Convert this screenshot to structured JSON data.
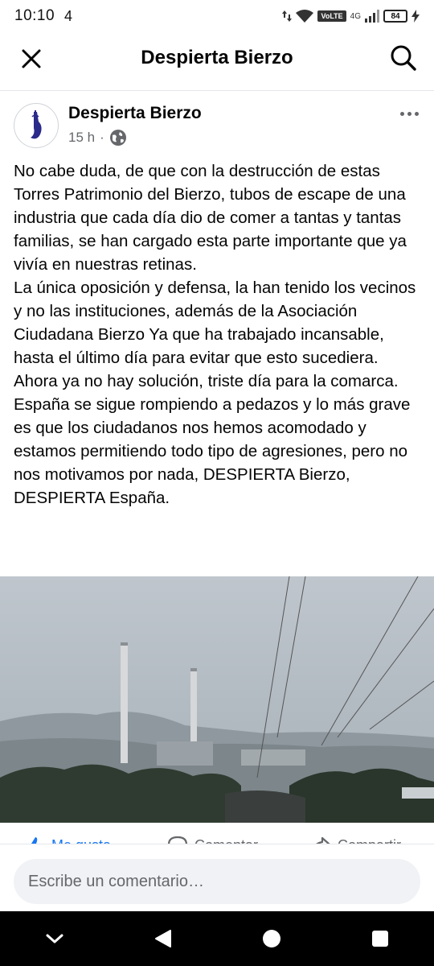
{
  "status_bar": {
    "time": "10:10",
    "extra": "4",
    "volte": "VoLTE",
    "network": "4G",
    "battery": "84"
  },
  "header": {
    "title": "Despierta Bierzo",
    "icons": [
      "close-icon",
      "search-icon"
    ]
  },
  "post": {
    "author": "Despierta Bierzo",
    "time": "15 h",
    "privacy_icon": "globe-icon",
    "paragraphs": [
      "No cabe duda, de que con la destrucción de estas Torres Patrimonio del Bierzo, tubos de escape de una industria que cada día dio de comer a tantas y tantas familias, se han cargado esta parte importante que ya vivía en nuestras retinas.",
      "La única oposición y defensa, la han tenido los vecinos y no las instituciones, además de la Asociación Ciudadana Bierzo Ya que ha trabajado incansable, hasta el último día para evitar que esto sucediera. Ahora ya no hay solución, triste día para la comarca. España se sigue rompiendo a pedazos y lo más grave es que los ciudadanos nos hemos acomodado y estamos permitiendo todo tipo de agresiones, pero no nos motivamos por nada, DESPIERTA Bierzo, DESPIERTA España."
    ]
  },
  "actions": {
    "like": "Me gusta",
    "comment": "Comentar",
    "share": "Compartir"
  },
  "comment_box": {
    "placeholder": "Escribe un comentario…"
  },
  "colors": {
    "accent": "#1877f2",
    "secondary_text": "#65676b",
    "input_bg": "#f0f2f5"
  }
}
